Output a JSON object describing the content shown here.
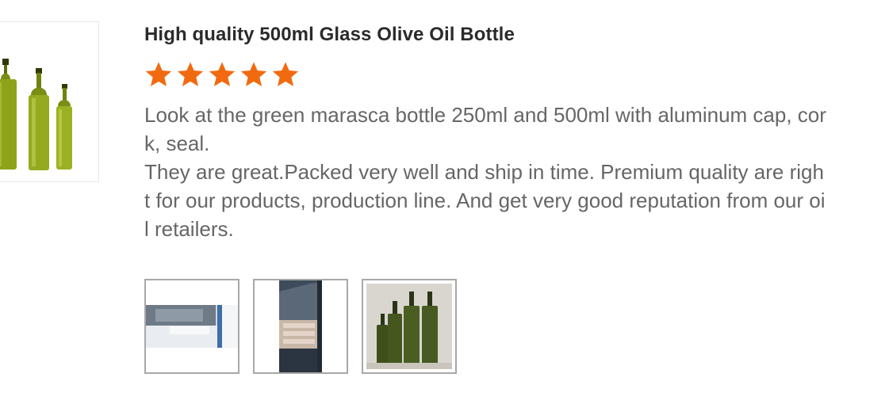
{
  "review": {
    "title": "High quality 500ml Glass Olive Oil Bottle",
    "rating": 5,
    "rating_max": 5,
    "text_lines": [
      "Look at the green marasca bottle 250ml and 500ml with aluminum cap, cork, seal.",
      "They are great.Packed very well and ship in time. Premium quality are right for our products, production line. And get very good reputation from our oil retailers."
    ],
    "photos": [
      {
        "name": "container-loading-photo"
      },
      {
        "name": "truck-loading-photo"
      },
      {
        "name": "green-bottles-photo"
      }
    ]
  },
  "colors": {
    "star": "#f26a10",
    "title": "#2b2b2b",
    "text": "#666666",
    "photo_border": "#a8a8a8"
  }
}
